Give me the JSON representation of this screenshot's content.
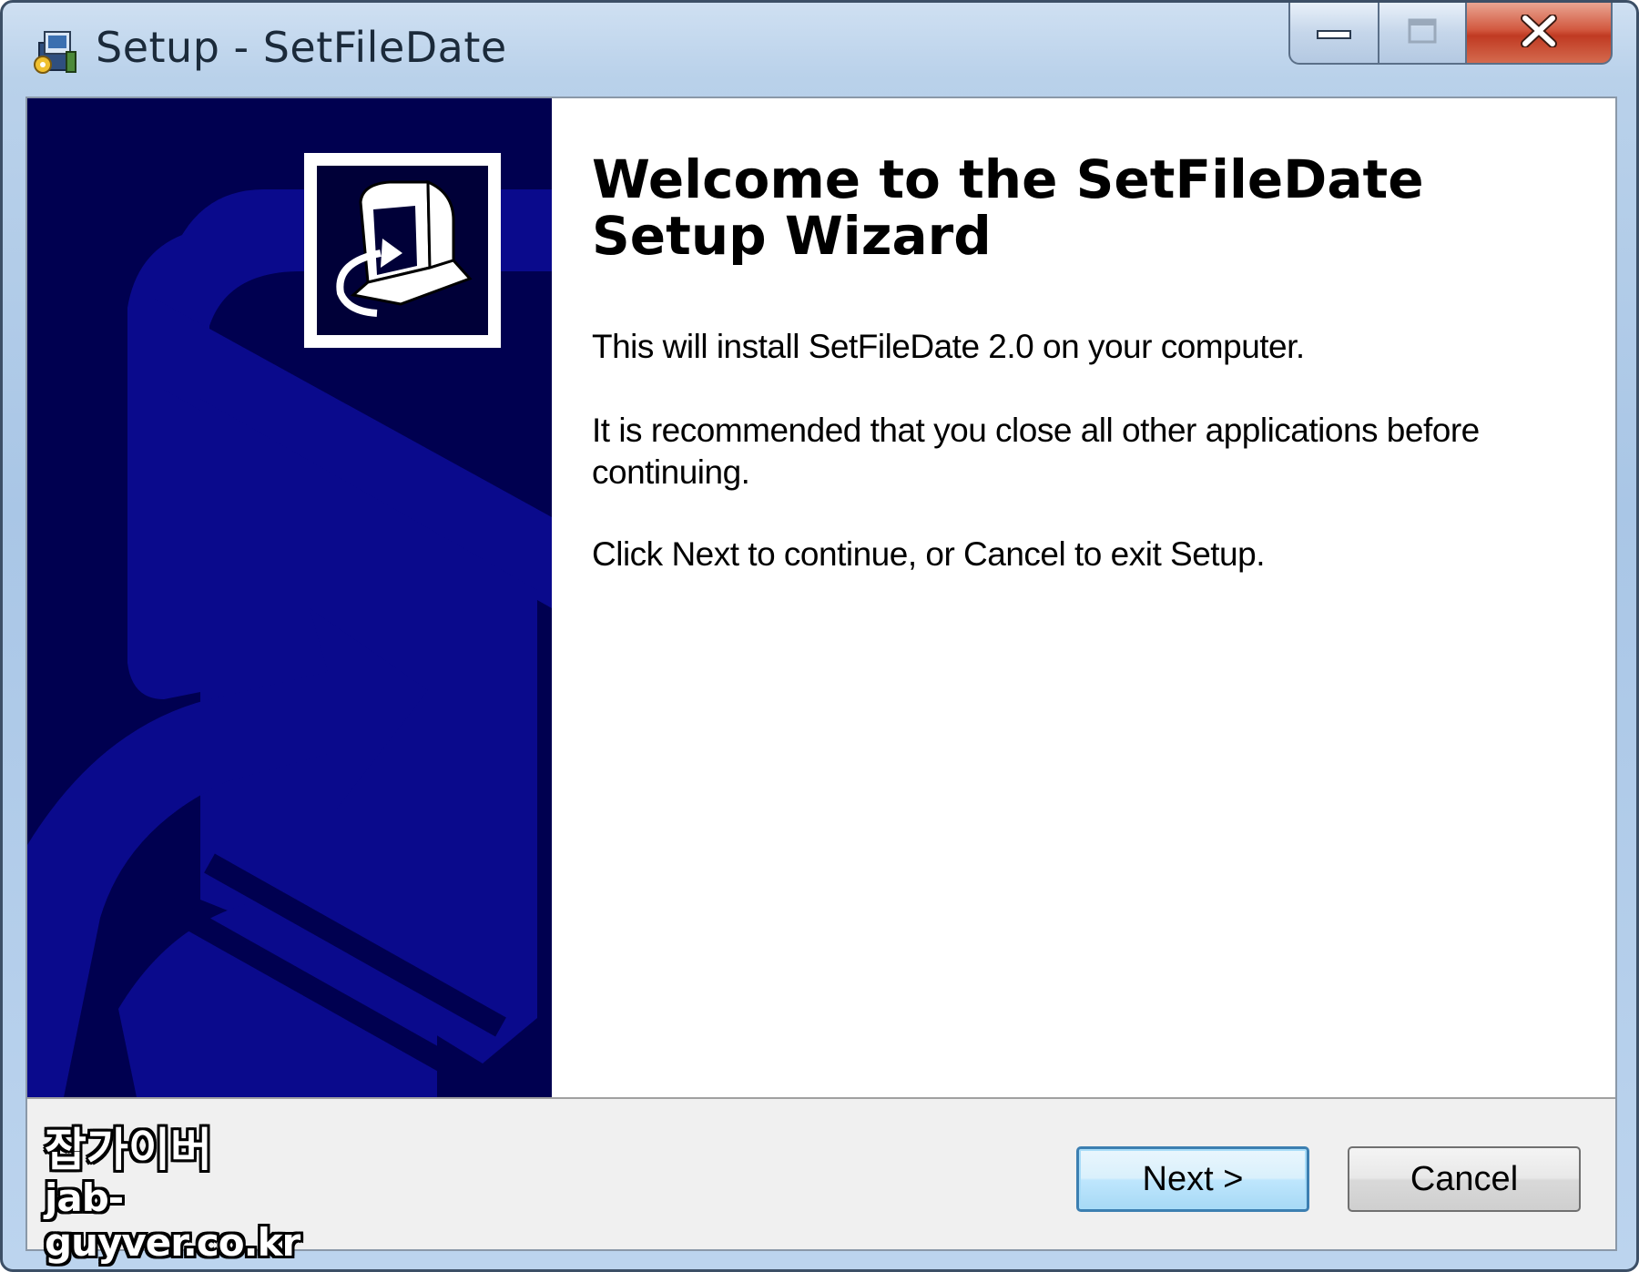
{
  "window": {
    "title": "Setup - SetFileDate",
    "icon": "setup-installer-icon",
    "caption_buttons": [
      "minimize-icon",
      "maximize-icon",
      "close-icon"
    ]
  },
  "wizard": {
    "side_image": "setup-computer-arrow-graphic",
    "welcome_title": "Welcome to the SetFileDate Setup Wizard",
    "paragraphs": [
      "This will install SetFileDate 2.0 on your computer.",
      "It is recommended that you close all other applications before continuing.",
      "Click Next to continue, or Cancel to exit Setup."
    ]
  },
  "buttons": {
    "next_label": "Next >",
    "cancel_label": "Cancel"
  },
  "watermark": {
    "line1": "잡가이버",
    "line2": "jab-guyver.co.kr"
  },
  "colors": {
    "side_panel": "#000050",
    "side_art": "#0a0a8c",
    "close_button": "#c7472c",
    "default_button_border": "#3c7fb1"
  }
}
